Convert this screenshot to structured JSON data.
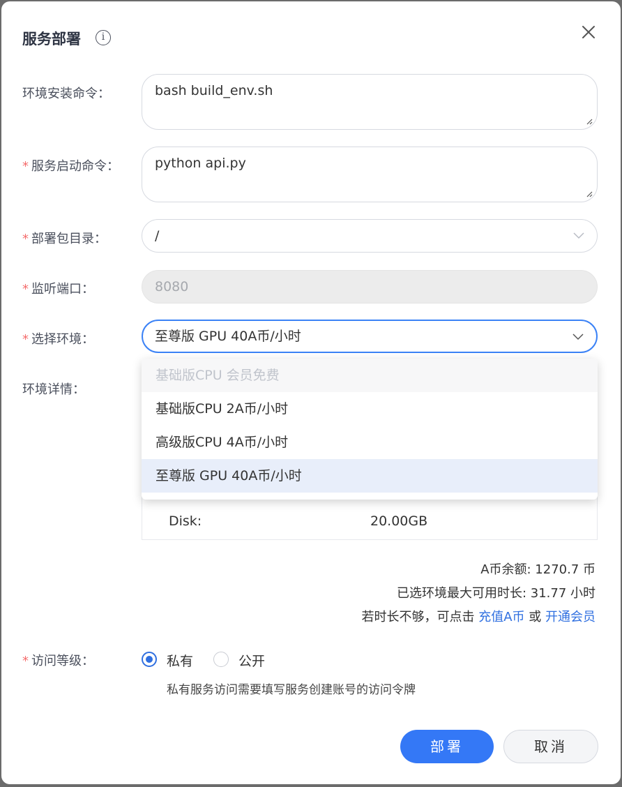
{
  "dialog": {
    "title": "服务部署",
    "info_icon_glyph": "i"
  },
  "form": {
    "env_install": {
      "label": "环境安装命令：",
      "value": "bash build_env.sh"
    },
    "start_cmd": {
      "required_mark": "*",
      "label": "服务启动命令：",
      "value": "python api.py"
    },
    "package_dir": {
      "required_mark": "*",
      "label": "部署包目录：",
      "value": "/"
    },
    "port": {
      "required_mark": "*",
      "label": "监听端口：",
      "value": "8080"
    },
    "env_select": {
      "required_mark": "*",
      "label": "选择环境：",
      "value": "至尊版 GPU 40A币/小时",
      "options": [
        {
          "label": "基础版CPU 会员免费",
          "disabled": true
        },
        {
          "label": "基础版CPU 2A币/小时"
        },
        {
          "label": "高级版CPU 4A币/小时"
        },
        {
          "label": "至尊版 GPU 40A币/小时",
          "selected": true
        }
      ]
    },
    "env_details": {
      "label": "环境详情：",
      "disk_key": "Disk:",
      "disk_value": "20.00GB"
    }
  },
  "balance": {
    "line1": "A币余额: 1270.7 币",
    "line2": "已选环境最大可用时长: 31.77 小时",
    "line3_prefix": "若时长不够，可点击",
    "recharge_link": "充值A币",
    "or_text": "或",
    "member_link": "开通会员"
  },
  "access": {
    "required_mark": "*",
    "label": "访问等级：",
    "private_label": "私有",
    "public_label": "公开",
    "selected": "private",
    "hint": "私有服务访问需要填写服务创建账号的访问令牌"
  },
  "buttons": {
    "deploy": "部署",
    "cancel": "取消"
  },
  "colors": {
    "primary": "#3478f6",
    "required": "#f56c6c",
    "link": "#2f6fe0"
  }
}
